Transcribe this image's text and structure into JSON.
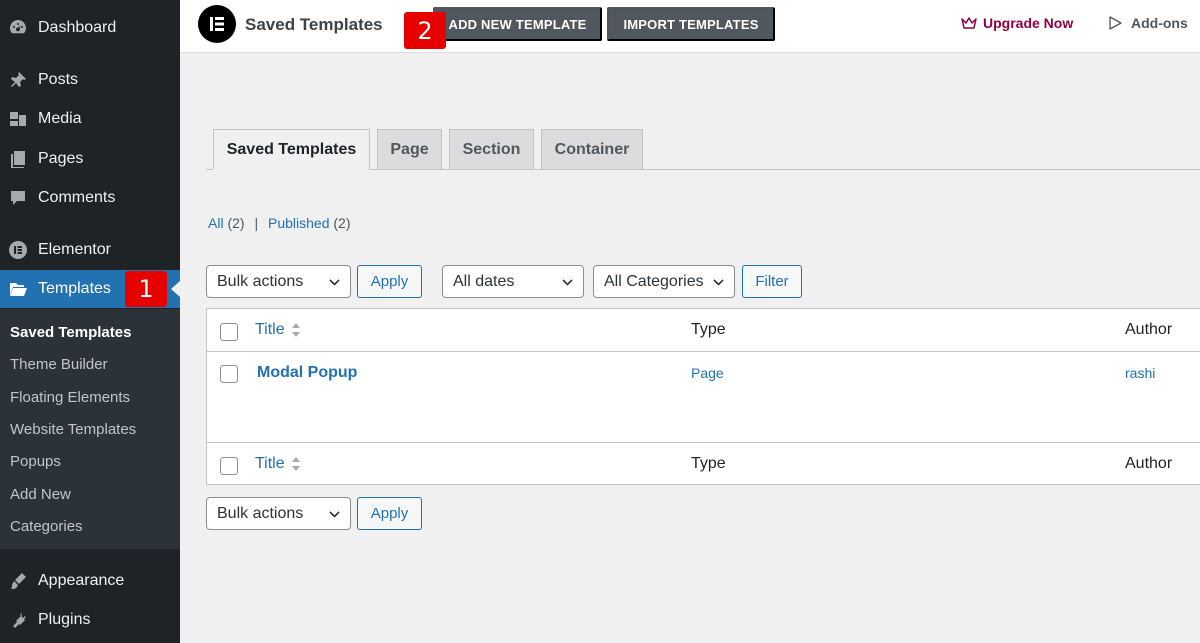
{
  "colors": {
    "sidebar_bg": "#1d2327",
    "accent": "#2271b1",
    "badge": "#e60000",
    "upgrade": "#93003f"
  },
  "sidebar": {
    "items": [
      {
        "label": "Dashboard",
        "icon": "dashboard-icon"
      },
      {
        "label": "Posts",
        "icon": "pin-icon"
      },
      {
        "label": "Media",
        "icon": "media-icon"
      },
      {
        "label": "Pages",
        "icon": "pages-icon"
      },
      {
        "label": "Comments",
        "icon": "comment-icon"
      },
      {
        "label": "Elementor",
        "icon": "elementor-icon"
      },
      {
        "label": "Templates",
        "icon": "folder-icon"
      },
      {
        "label": "Appearance",
        "icon": "brush-icon"
      },
      {
        "label": "Plugins",
        "icon": "plug-icon"
      }
    ],
    "submenu": [
      "Saved Templates",
      "Theme Builder",
      "Floating Elements",
      "Website Templates",
      "Popups",
      "Add New",
      "Categories"
    ]
  },
  "badges": {
    "one": "1",
    "two": "2"
  },
  "topbar": {
    "title": "Saved Templates",
    "add_new": "ADD NEW TEMPLATE",
    "import": "IMPORT TEMPLATES",
    "upgrade": "Upgrade Now",
    "addons": "Add-ons"
  },
  "tabs": [
    "Saved Templates",
    "Page",
    "Section",
    "Container"
  ],
  "filters": {
    "all_label": "All",
    "all_count": "(2)",
    "separator": "|",
    "published_label": "Published",
    "published_count": "(2)",
    "bulk_actions": "Bulk actions",
    "apply": "Apply",
    "all_dates": "All dates",
    "all_categories": "All Categories",
    "filter": "Filter"
  },
  "table": {
    "columns": {
      "title": "Title",
      "type": "Type",
      "author": "Author"
    },
    "rows": [
      {
        "title": "Modal Popup",
        "type": "Page",
        "author": "rashi"
      }
    ]
  }
}
